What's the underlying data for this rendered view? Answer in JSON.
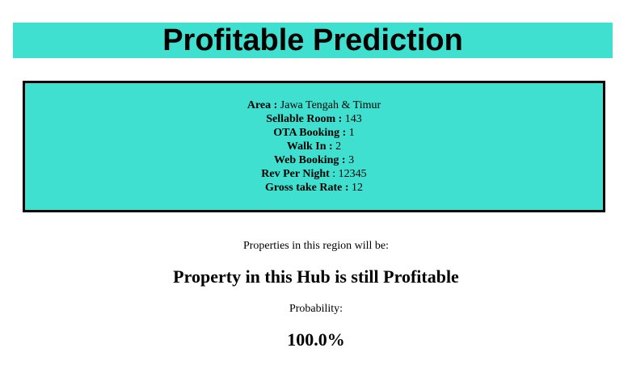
{
  "header": {
    "title": "Profitable Prediction"
  },
  "inputs": {
    "rows": [
      {
        "label": "Area :",
        "value": " Jawa Tengah & Timur"
      },
      {
        "label": "Sellable Room :",
        "value": " 143"
      },
      {
        "label": "OTA Booking :",
        "value": " 1"
      },
      {
        "label": "Walk In :",
        "value": " 2"
      },
      {
        "label": "Web Booking :",
        "value": " 3"
      },
      {
        "label": "Rev Per Night",
        "value": " : 12345"
      },
      {
        "label": "Gross take Rate :",
        "value": " 12"
      }
    ]
  },
  "result": {
    "region_caption": "Properties in this region will be:",
    "prediction": "Property in this Hub is still Profitable",
    "probability_caption": "Probability:",
    "probability_value": "100.0%"
  },
  "colors": {
    "accent": "#40e0d0",
    "border": "#000000"
  }
}
